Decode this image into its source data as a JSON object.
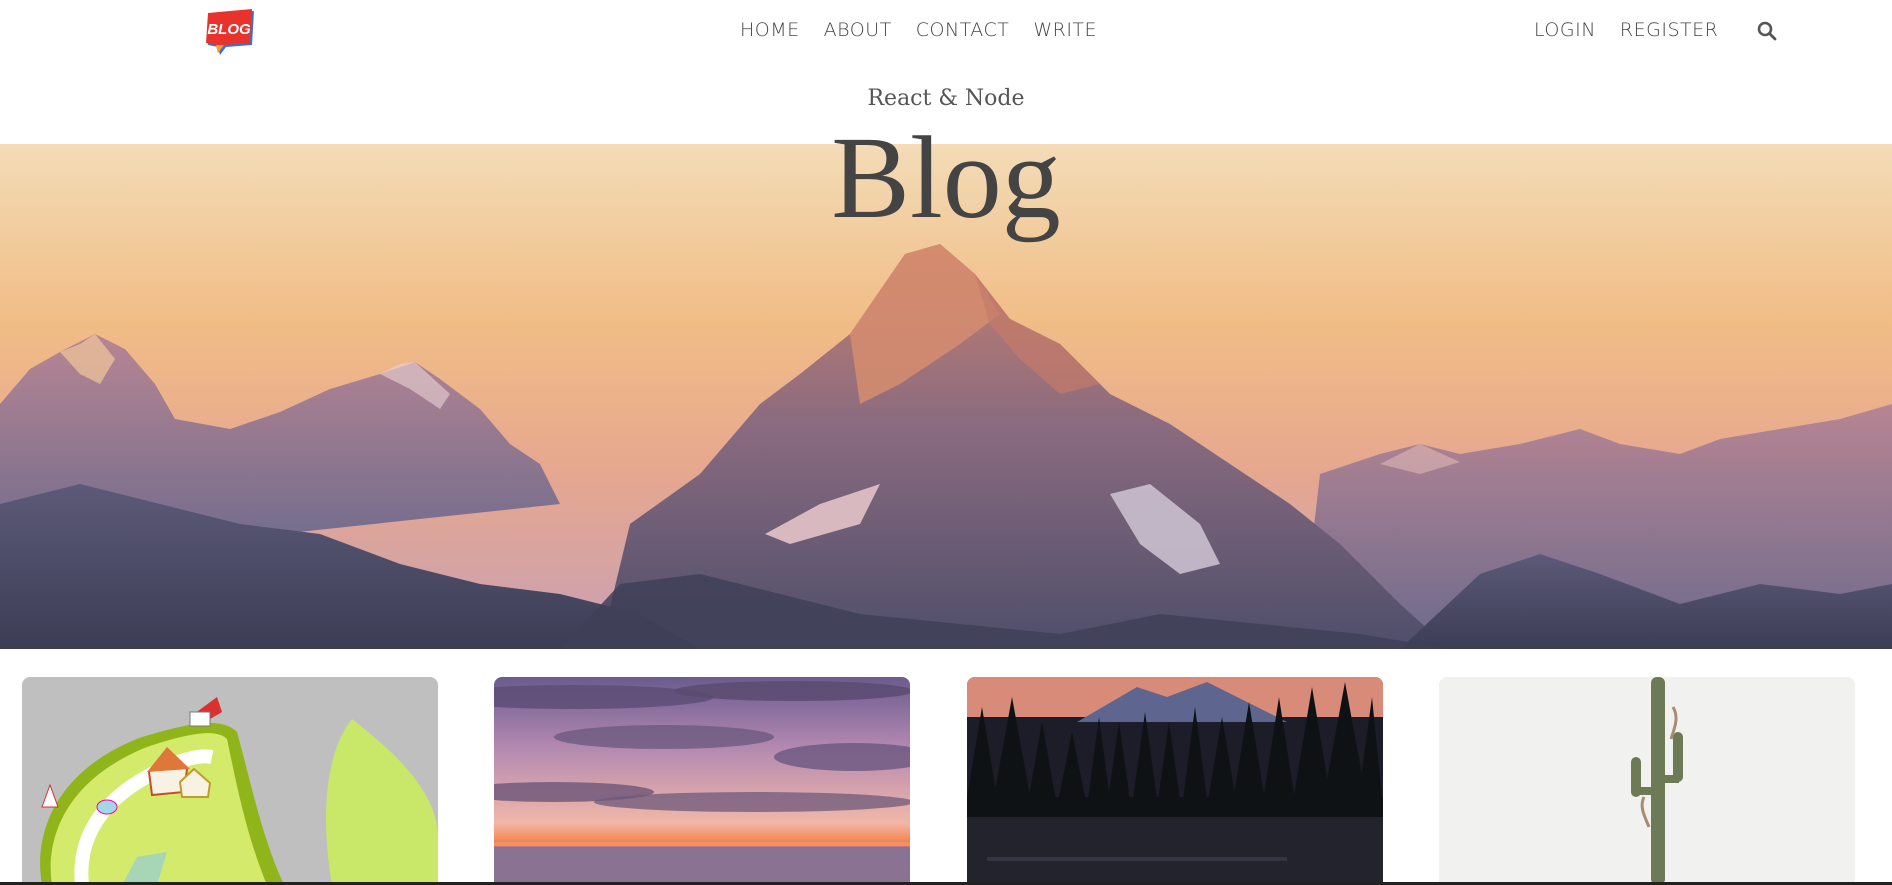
{
  "navbar": {
    "logo_text": "BLOG",
    "center_items": [
      {
        "label": "HOME"
      },
      {
        "label": "ABOUT"
      },
      {
        "label": "CONTACT"
      },
      {
        "label": "WRITE"
      }
    ],
    "right_items": [
      {
        "label": "LOGIN"
      },
      {
        "label": "REGISTER"
      }
    ],
    "search_icon": "search-icon"
  },
  "header": {
    "subtitle": "React & Node",
    "title": "Blog"
  },
  "posts": [
    {
      "image": "temple-illustration"
    },
    {
      "image": "sunset-sea"
    },
    {
      "image": "forest-mountain-dusk"
    },
    {
      "image": "cactus-white-wall"
    }
  ],
  "colors": {
    "logo_red": "#e8322c",
    "logo_blue": "#3b6fd8",
    "logo_orange": "#f2a03a",
    "nav_text": "#444444"
  }
}
